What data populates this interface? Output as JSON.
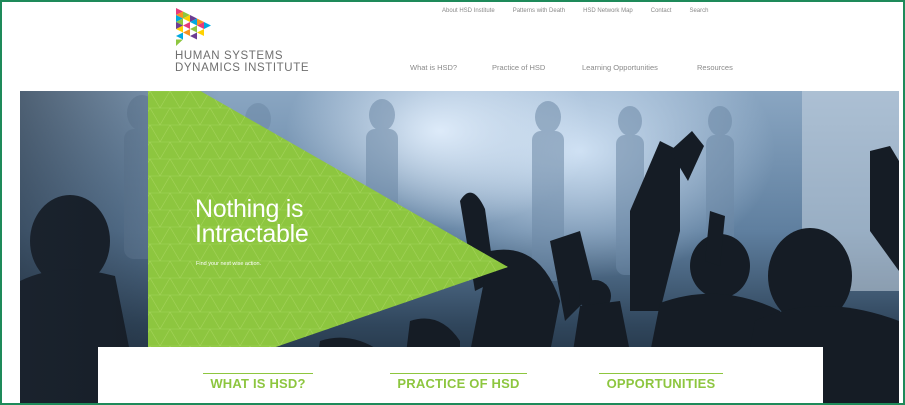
{
  "brand": {
    "line1": "HUMAN SYSTEMS",
    "line2": "DYNAMICS INSTITUTE",
    "logo_icon": "triangle-logo-icon"
  },
  "utility_nav": [
    "About HSD Institute",
    "Patterns with Death",
    "HSD Network Map",
    "Contact",
    "Search"
  ],
  "main_nav": [
    "What is HSD?",
    "Practice of HSD",
    "Learning Opportunities",
    "Resources"
  ],
  "hero": {
    "headline_line1": "Nothing is",
    "headline_line2": "Intractable",
    "tagline": "Find your next wise action."
  },
  "sections": [
    "WHAT IS HSD?",
    "PRACTICE OF HSD",
    "OPPORTUNITIES"
  ],
  "colors": {
    "accent_green": "#8dc63f",
    "frame_border": "#1e8a5a",
    "nav_gray": "#8a8a8a"
  }
}
